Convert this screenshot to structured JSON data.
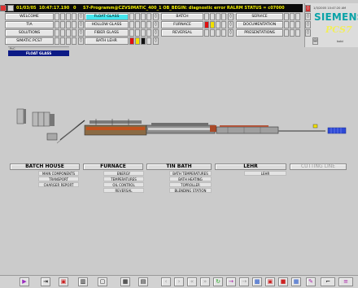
{
  "alarm": {
    "date": "01/03/05",
    "time": "10:47:17.190",
    "number": "0",
    "message": "S7-Programm@CZVSIMATIC_400_1   OB_BEGIN: diagnostic error RALRM STATUS = c07000"
  },
  "nav": {
    "col1": [
      "WELCOME",
      "TIA",
      "SOLUTIONS",
      "SIMATIC PCS7"
    ],
    "col2": [
      "FLOAT GLASS",
      "HOLLOW GLASS",
      "FIBER GLASS",
      "BATH LEHR"
    ],
    "col3": [
      "BATCH",
      "FURNACE",
      "REVERSAL"
    ],
    "col4": [
      "SERVICE",
      "DOCUMENTATION",
      "PRESENTATIONS"
    ]
  },
  "brand": {
    "name": "SIEMENS",
    "product": "PCS7",
    "datetime": "1/3/2005 10:47:20 AM",
    "user": "kobi"
  },
  "tree": {
    "top_label": "PcC",
    "selected": "FLOAT GLASS"
  },
  "sections": [
    {
      "title": "BATCH HOUSE",
      "items": [
        "MAIN COMPONENTS",
        "TRANSPORT",
        "CHARGER REPORT"
      ]
    },
    {
      "title": "FURNACE",
      "items": [
        "ENERGY",
        "TEMPERATURES",
        "OIL CONTROL",
        "REVERSAL"
      ]
    },
    {
      "title": "TIN BATH",
      "items": [
        "BATH TEMPERATURES",
        "BATH HEATING",
        "TOPROLLER",
        "BLENDING STATION"
      ]
    },
    {
      "title": "LEHR",
      "items": [
        "LEHR"
      ]
    },
    {
      "title": "CUTTING LINE",
      "items": []
    }
  ],
  "colors": {
    "accent_cyan": "#46e6ee",
    "selection_blue": "#0c1a86",
    "alarm_yellow": "#f4f000",
    "siemens_teal": "#0aa3a8"
  }
}
